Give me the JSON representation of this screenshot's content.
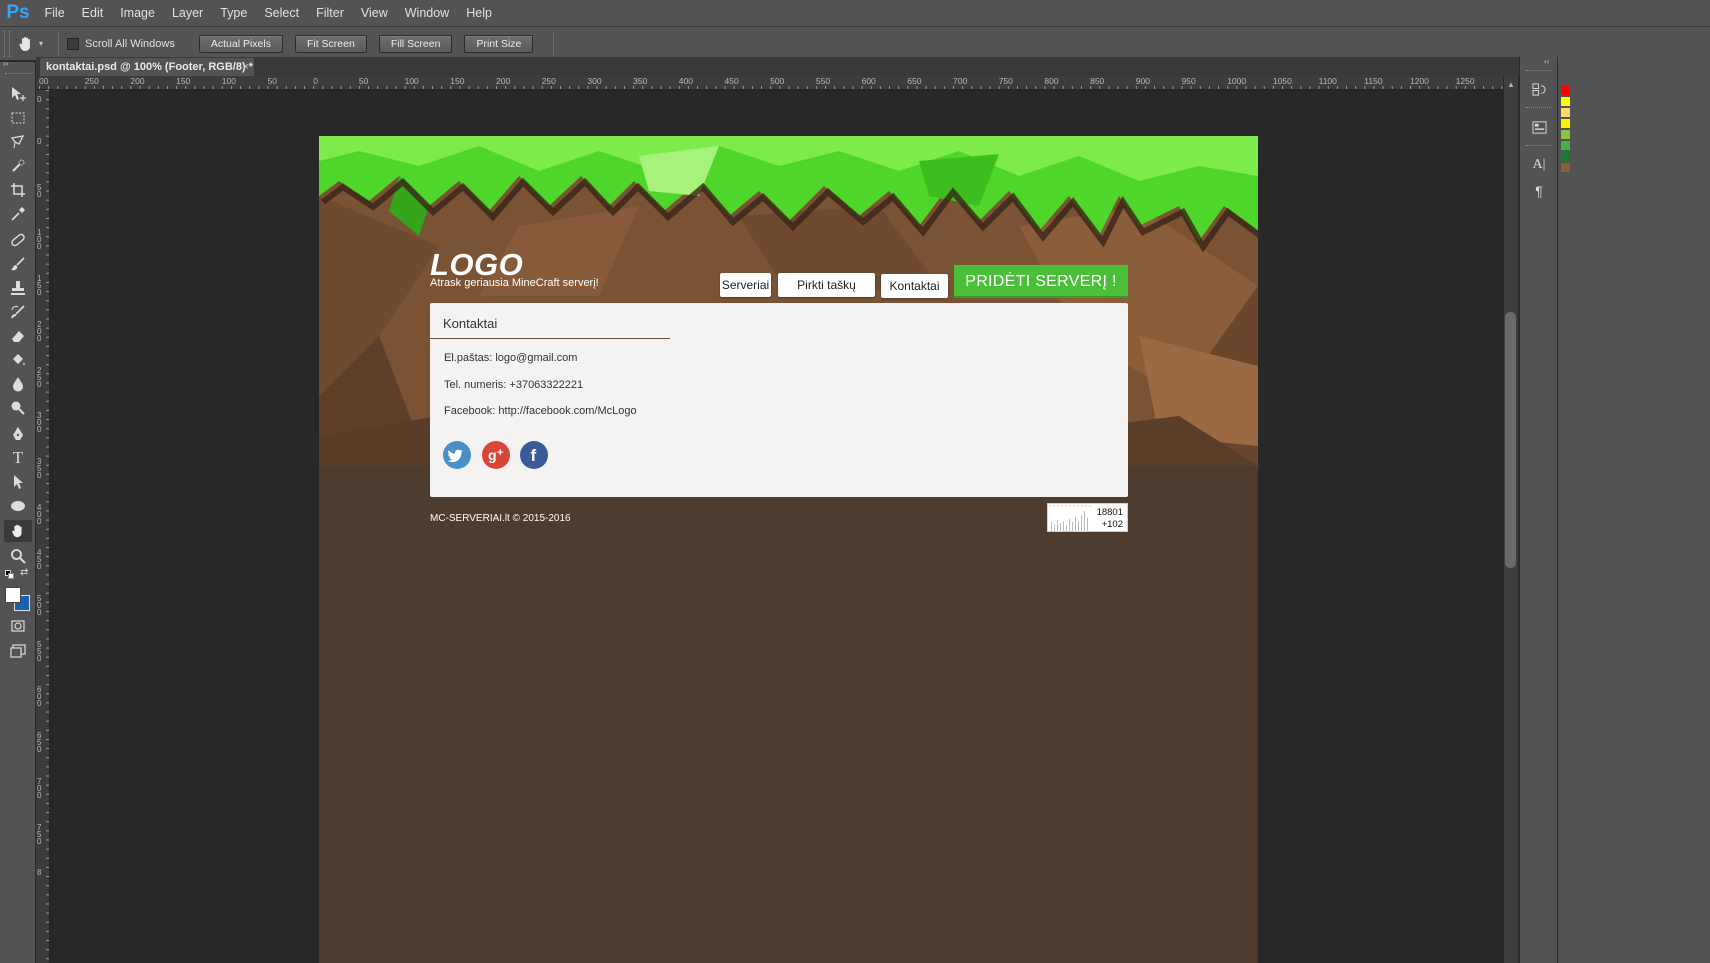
{
  "app": {
    "logo": "Ps"
  },
  "menu": [
    "File",
    "Edit",
    "Image",
    "Layer",
    "Type",
    "Select",
    "Filter",
    "View",
    "Window",
    "Help"
  ],
  "options": {
    "scroll_all_windows": "Scroll All Windows",
    "buttons": [
      "Actual Pixels",
      "Fit Screen",
      "Fill Screen",
      "Print Size"
    ]
  },
  "tab": {
    "title": "kontaktai.psd @ 100% (Footer, RGB/8) *",
    "close": "×"
  },
  "ruler": {
    "top": [
      "00",
      "250",
      "200",
      "150",
      "100",
      "50",
      "0",
      "50",
      "100",
      "150",
      "200",
      "250",
      "300",
      "350",
      "400",
      "450",
      "500",
      "550",
      "600",
      "650",
      "700",
      "750",
      "800",
      "850",
      "900",
      "950",
      "1000",
      "1050",
      "1100",
      "1150",
      "1200",
      "1250"
    ],
    "left": [
      "0",
      "0",
      "50",
      "100",
      "150",
      "200",
      "250",
      "300",
      "350",
      "400",
      "450",
      "500",
      "550",
      "600",
      "650",
      "700",
      "750",
      "8"
    ]
  },
  "site": {
    "logo": "LOGO",
    "tagline": "Atrask geriausia MineCraft serverį!",
    "nav": [
      "Serveriai",
      "Pirkti taškų",
      "Kontaktai"
    ],
    "add_server": "PRIDĖTI SERVERĮ !",
    "contact_heading": "Kontaktai",
    "email": "El.paštas: logo@gmail.com",
    "phone": "Tel. numeris: +37063322221",
    "facebook": "Facebook: http://facebook.com/McLogo",
    "copyright": "MC-SERVERIAI.lt © 2015-2016",
    "counter_total": "18801",
    "counter_today": "+102"
  },
  "colors": {
    "grass": "#4fd62a",
    "dirt": "#7a5234",
    "dirt_dark": "#4e3c2e",
    "accent_green": "#4cbf3a",
    "twitter": "#4a90c8",
    "gplus": "#d9453a",
    "facebook": "#3b5a98"
  },
  "swatches": [
    "#ff0000",
    "#ffff00",
    "#ffd966",
    "#fff200",
    "#8cc63f",
    "#39b54a",
    "#197b30",
    "#8b5e3c"
  ],
  "icons": {
    "tools": [
      "move-icon",
      "marquee-icon",
      "lasso-icon",
      "quick-select-icon",
      "crop-icon",
      "eyedropper-icon",
      "healing-brush-icon",
      "brush-icon",
      "clone-stamp-icon",
      "history-brush-icon",
      "eraser-icon",
      "paint-bucket-icon",
      "blur-icon",
      "dodge-icon",
      "pen-icon",
      "type-icon",
      "path-select-icon",
      "ellipse-icon",
      "hand-icon",
      "zoom-icon"
    ]
  }
}
